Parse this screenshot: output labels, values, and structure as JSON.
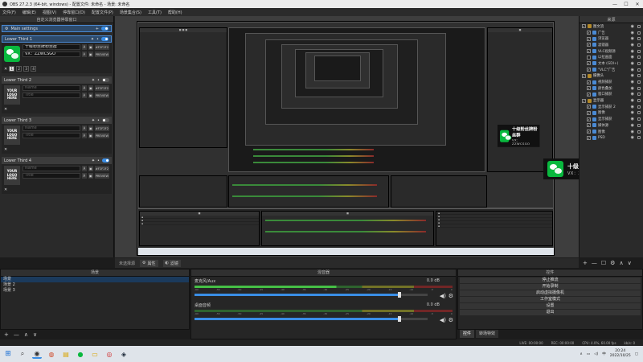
{
  "window": {
    "title": "OBS 27.2.3 (64-bit, windows) - 配置文件: 未命名 - 场景: 未命名",
    "controls": [
      "—",
      "☐",
      "✕"
    ]
  },
  "menu": [
    "文件(F)",
    "编辑(E)",
    "视图(V)",
    "停靠窗口(D)",
    "配置文件(P)",
    "场景集合(S)",
    "工具(T)",
    "帮助(H)"
  ],
  "left_dock": {
    "title": "自定义浏览器停靠窗口",
    "main_settings": "Main settings",
    "lower_thirds": [
      {
        "name": "Lower Third 1",
        "title": "十级粉丝牌粉丝群",
        "subtitle": "VX：ZZWCSGO",
        "logo": "wechat",
        "enabled": true,
        "active": true,
        "color": "#F2F2F2"
      },
      {
        "name": "Lower Third 2",
        "title": "",
        "subtitle": "",
        "logo": "text",
        "enabled": false,
        "active": false,
        "color": "#F2F2F2"
      },
      {
        "name": "Lower Third 3",
        "title": "",
        "subtitle": "",
        "logo": "text",
        "enabled": false,
        "active": false,
        "color": "#F2F2F2"
      },
      {
        "name": "Lower Third 4",
        "title": "",
        "subtitle": "",
        "logo": "text",
        "enabled": true,
        "active": false,
        "color": "#F2F2F2"
      }
    ],
    "logo_text_lines": [
      "YOUR",
      "LOGO",
      "HERE"
    ],
    "title_placeholder": "Name",
    "subtitle_placeholder": "Title",
    "hex_label": "#F2F2F2",
    "preview_label": "PREVIEW",
    "font_btn": "A",
    "number_buttons": [
      "1",
      "2",
      "3",
      "4"
    ]
  },
  "preview": {
    "lower_third": {
      "title": "十级粉丝牌粉丝群",
      "subtitle": "VX：ZZWCSGO"
    }
  },
  "sources": {
    "title": "来源",
    "items": [
      {
        "name": "图文流",
        "type": "folder",
        "indent": 0,
        "checked": true
      },
      {
        "name": "广告",
        "type": "item",
        "indent": 1,
        "checked": true
      },
      {
        "name": "浏览器",
        "type": "item",
        "indent": 1,
        "checked": true
      },
      {
        "name": "滤镜器",
        "type": "item",
        "indent": 1,
        "checked": true
      },
      {
        "name": "VLC视频源",
        "type": "item",
        "indent": 1,
        "checked": true
      },
      {
        "name": "以拉画面",
        "type": "item",
        "indent": 1,
        "checked": false
      },
      {
        "name": "文本 (GDI+)",
        "type": "item",
        "indent": 1,
        "checked": true
      },
      {
        "name": "\"VLC\"广告",
        "type": "item",
        "indent": 1,
        "checked": true
      },
      {
        "name": "摄像头",
        "type": "folder",
        "indent": 0,
        "checked": true
      },
      {
        "name": "视频捕获",
        "type": "item",
        "indent": 1,
        "checked": true
      },
      {
        "name": "颜色叠加",
        "type": "item",
        "indent": 1,
        "checked": true
      },
      {
        "name": "窗口捕获",
        "type": "item",
        "indent": 1,
        "checked": true
      },
      {
        "name": "显示器",
        "type": "folder",
        "indent": 0,
        "checked": true
      },
      {
        "name": "显示捕获 2",
        "type": "item",
        "indent": 1,
        "checked": true
      },
      {
        "name": "图像",
        "type": "item",
        "indent": 1,
        "checked": true
      },
      {
        "name": "显示捕获",
        "type": "item",
        "indent": 1,
        "checked": true
      },
      {
        "name": "媒体源",
        "type": "item",
        "indent": 1,
        "checked": true
      },
      {
        "name": "图像",
        "type": "item",
        "indent": 1,
        "checked": true
      },
      {
        "name": "PSD",
        "type": "item",
        "indent": 1,
        "checked": true
      }
    ],
    "toolbar": [
      "+",
      "—",
      "☐",
      "⚙",
      "∧",
      "∨"
    ]
  },
  "nosource": {
    "label": "未选择源",
    "properties": "属性",
    "filters": "滤镜"
  },
  "scenes": {
    "title": "场景",
    "items": [
      "场景",
      "场景 2",
      "场景 3"
    ],
    "selected": 0,
    "toolbar": [
      "+",
      "—",
      "∧",
      "∨"
    ]
  },
  "mixer": {
    "title": "混音器",
    "channels": [
      {
        "name": "麦克风/Aux",
        "db": "0.0 dB",
        "level": 0.88,
        "live": true
      },
      {
        "name": "桌面音频",
        "db": "0.0 dB",
        "level": 0.88,
        "live": false
      }
    ],
    "scale": [
      "-60",
      "-55",
      "-50",
      "-45",
      "-40",
      "-35",
      "-30",
      "-25",
      "-20",
      "-15",
      "-10",
      "-5",
      "0"
    ]
  },
  "controls": {
    "title": "控件",
    "buttons": [
      "停止推流",
      "开始录制",
      "启动虚拟摄像机",
      "工作室模式",
      "设置",
      "退出"
    ],
    "tabs": [
      "控件",
      "转场特效"
    ],
    "selected_tab": 0
  },
  "status": {
    "live": "LIVE: 00:00:00",
    "rec": "REC: 00:00:00",
    "cpu": "CPU: 4.0%, 60.00 fps",
    "dropped": "kb/s: 0"
  },
  "taskbar": {
    "icons": [
      "windows-icon",
      "search-icon",
      "obs-icon",
      "chrome-icon",
      "notes-icon",
      "wechat-icon",
      "folder-icon",
      "weibo-icon",
      "steam-icon"
    ],
    "time": "20:24",
    "date": "2022/10/25",
    "ime": "中"
  }
}
